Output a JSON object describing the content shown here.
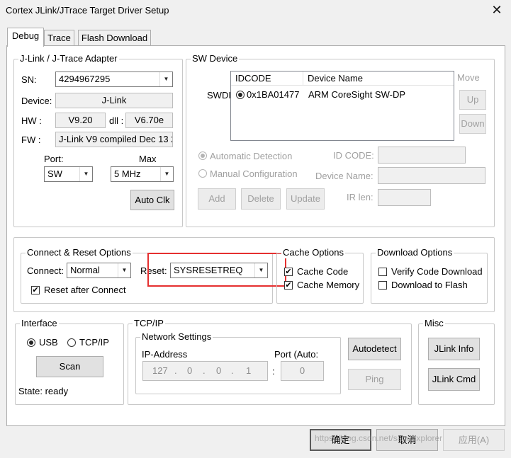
{
  "window": {
    "title": "Cortex JLink/JTrace Target Driver Setup",
    "close_glyph": "✕"
  },
  "tabs": [
    {
      "label": "Debug",
      "active": true
    },
    {
      "label": "Trace"
    },
    {
      "label": "Flash Download"
    }
  ],
  "adapter": {
    "group_title": "J-Link / J-Trace Adapter",
    "sn_label": "SN:",
    "sn_value": "4294967295",
    "device_label": "Device:",
    "device_value": "J-Link",
    "hw_label": "HW :",
    "hw_value": "V9.20",
    "dll_label": "dll :",
    "dll_value": "V6.70e",
    "fw_label": "FW :",
    "fw_value": "J-Link V9 compiled Dec 13 2",
    "port_label": "Port:",
    "port_value": "SW",
    "max_label": "Max",
    "max_value": "5 MHz",
    "auto_clk": "Auto Clk"
  },
  "sw_device": {
    "group_title": "SW Device",
    "move_label": "Move",
    "swdi_label": "SWDI",
    "columns": [
      "IDCODE",
      "Device Name"
    ],
    "rows": [
      {
        "idcode": "0x1BA01477",
        "name": "ARM CoreSight SW-DP"
      }
    ],
    "up": "Up",
    "down": "Down",
    "auto_detection": "Automatic Detection",
    "manual_config": "Manual Configuration",
    "id_code_label": "ID CODE:",
    "device_name_label": "Device Name:",
    "ir_len_label": "IR len:",
    "add": "Add",
    "delete": "Delete",
    "update": "Update"
  },
  "connect_reset": {
    "group_title": "Connect & Reset Options",
    "connect_label": "Connect:",
    "connect_value": "Normal",
    "reset_label": "Reset:",
    "reset_value": "SYSRESETREQ",
    "reset_after_connect": "Reset after Connect"
  },
  "cache": {
    "group_title": "Cache Options",
    "cache_code": "Cache Code",
    "cache_memory": "Cache Memory"
  },
  "download": {
    "group_title": "Download Options",
    "verify": "Verify Code Download",
    "to_flash": "Download to Flash"
  },
  "interface": {
    "group_title": "Interface",
    "usb": "USB",
    "tcpip": "TCP/IP",
    "scan": "Scan",
    "state": "State: ready"
  },
  "tcp": {
    "group_title": "TCP/IP",
    "net_title": "Network Settings",
    "ip_label": "IP-Address",
    "ip": [
      "127",
      "0",
      "0",
      "1"
    ],
    "ip_sep": ".",
    "port_label": "Port (Auto:",
    "port_sep": ":",
    "port_value": "0",
    "autodetect": "Autodetect",
    "ping": "Ping"
  },
  "misc": {
    "group_title": "Misc",
    "jlink_info": "JLink Info",
    "jlink_cmd": "JLink Cmd"
  },
  "footer": {
    "ok": "确定",
    "cancel": "取消",
    "apply": "应用(A)"
  },
  "watermark": "https://blog.csdn.net/sagaexplorer"
}
